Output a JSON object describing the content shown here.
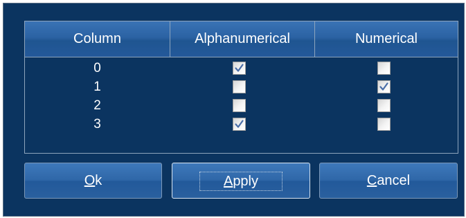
{
  "grid": {
    "headers": [
      "Column",
      "Alphanumerical",
      "Numerical"
    ],
    "rows": [
      {
        "column": "0",
        "alphanumerical": true,
        "numerical": false
      },
      {
        "column": "1",
        "alphanumerical": false,
        "numerical": true
      },
      {
        "column": "2",
        "alphanumerical": false,
        "numerical": false
      },
      {
        "column": "3",
        "alphanumerical": true,
        "numerical": false
      }
    ]
  },
  "buttons": {
    "ok": {
      "mnemonic": "O",
      "rest": "k"
    },
    "apply": {
      "mnemonic": "A",
      "rest": "pply"
    },
    "cancel": {
      "mnemonic": "C",
      "rest": "ancel"
    }
  },
  "colors": {
    "dialog_background": "#0b3460",
    "header_gradient_top": "#3a73b5",
    "button_gradient_top": "#3e79bb",
    "check_color": "#4a6ea8"
  }
}
